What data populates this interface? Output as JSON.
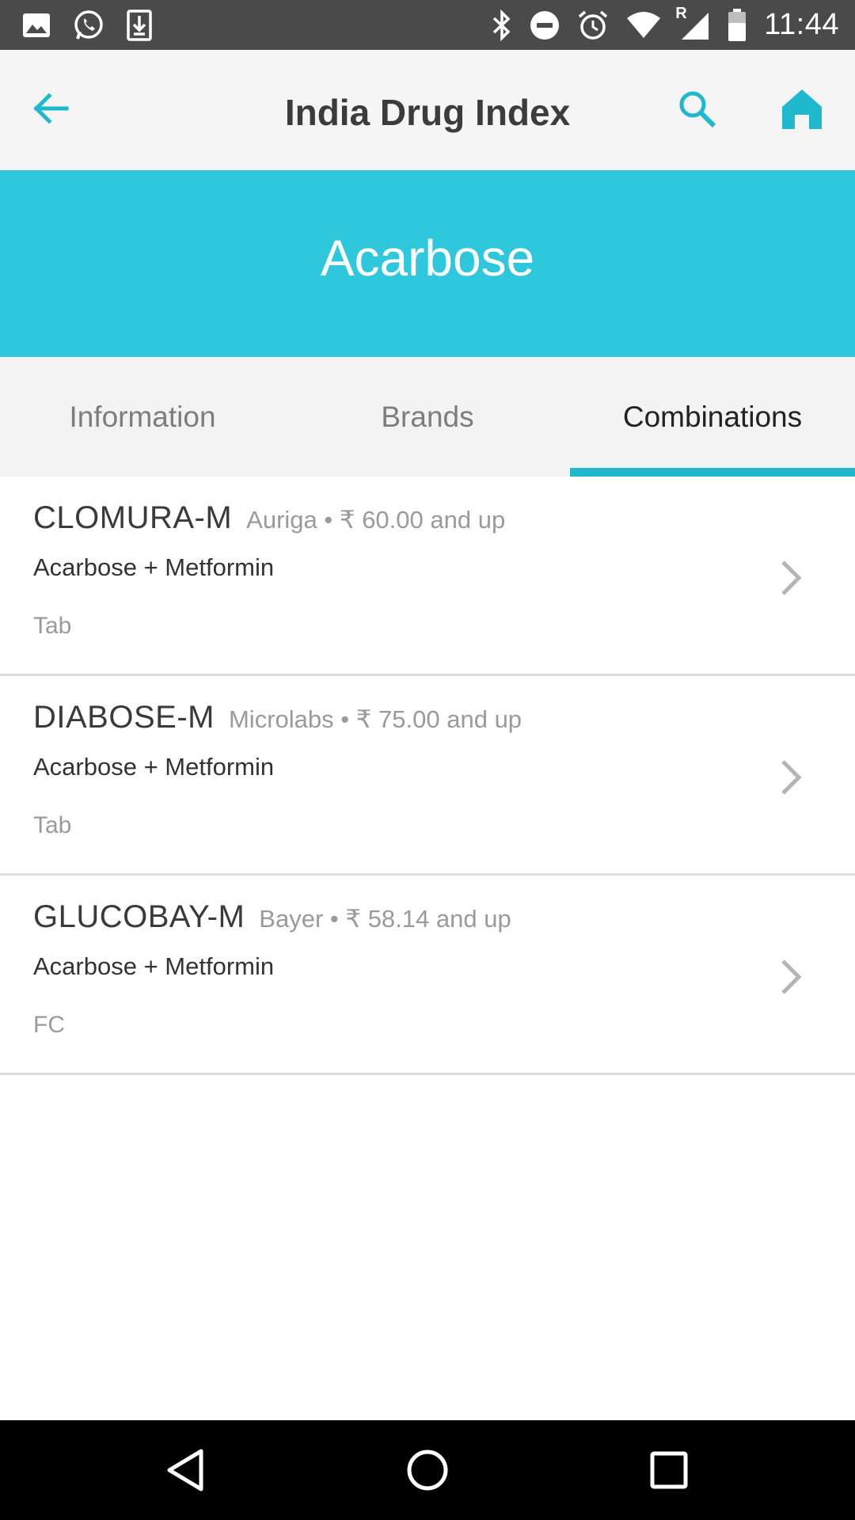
{
  "status_bar": {
    "time": "11:44",
    "left_icons": [
      "image-icon",
      "whatsapp-icon",
      "download-icon"
    ],
    "right_icons": [
      "bluetooth-icon",
      "do-not-disturb-icon",
      "alarm-icon",
      "wifi-icon",
      "signal-roaming-icon",
      "battery-icon"
    ],
    "roaming_label": "R"
  },
  "app_bar": {
    "title": "India Drug Index",
    "accent_color": "#1fb8cf"
  },
  "banner": {
    "drug_name": "Acarbose",
    "color": "#2ec7dc"
  },
  "tabs": [
    {
      "label": "Information",
      "active": false
    },
    {
      "label": "Brands",
      "active": false
    },
    {
      "label": "Combinations",
      "active": true
    }
  ],
  "combinations": [
    {
      "brand": "CLOMURA-M",
      "meta": "Auriga • ₹ 60.00 and up",
      "composition": "Acarbose + Metformin",
      "form": "Tab"
    },
    {
      "brand": "DIABOSE-M",
      "meta": "Microlabs • ₹ 75.00 and up",
      "composition": "Acarbose + Metformin",
      "form": "Tab"
    },
    {
      "brand": "GLUCOBAY-M",
      "meta": "Bayer • ₹ 58.14 and up",
      "composition": "Acarbose + Metformin",
      "form": "FC"
    }
  ]
}
